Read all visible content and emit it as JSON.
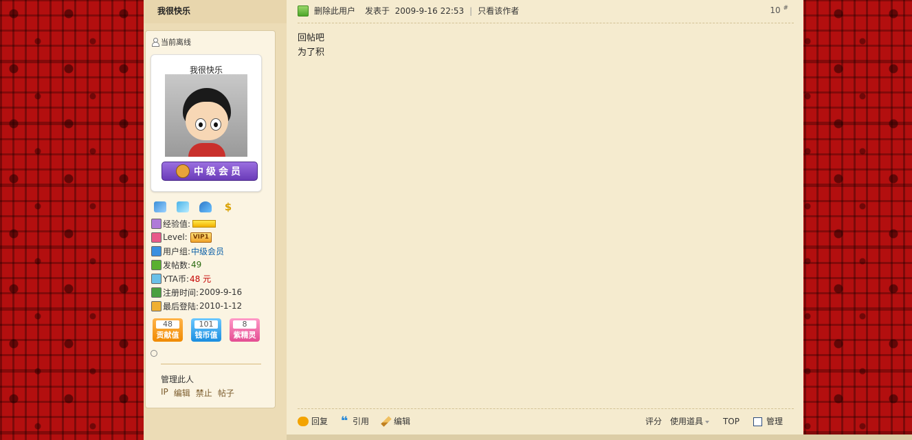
{
  "author": {
    "name": "我很快乐",
    "status": "当前离线",
    "rank_title": "中级会员",
    "stats": {
      "exp_label": "经验值:",
      "level_label": "Level:",
      "level_value": "VIP1",
      "group_label": "用户组:",
      "group_value": "中级会员",
      "posts_label": "发帖数:",
      "posts_value": "49",
      "coins_label": "YTA币:",
      "coins_value": "48 元",
      "reg_label": "注册时间:",
      "reg_value": "2009-9-16",
      "login_label": "最后登陆:",
      "login_value": "2010-1-12"
    },
    "badges": [
      {
        "value": "48",
        "label": "贡献值"
      },
      {
        "value": "101",
        "label": "钱币值"
      },
      {
        "value": "8",
        "label": "紫精灵"
      }
    ],
    "manage_title": "管理此人",
    "manage_links": [
      "IP",
      "编辑",
      "禁止",
      "帖子"
    ]
  },
  "post": {
    "delete_user": "删除此用户",
    "posted_at": "发表于  2009-9-16 22:53",
    "separator": "|",
    "only_author": "只看该作者",
    "floor": "10",
    "floor_mark": "#",
    "lines": [
      "回帖吧",
      "为了积"
    ]
  },
  "footer": {
    "reply": "回复",
    "quote": "引用",
    "edit": "编辑",
    "rate": "评分",
    "use_tool": "使用道具",
    "top": "TOP",
    "manage": "管理"
  },
  "colors": {
    "page_bg": "#b30f0f",
    "post_bg": "#f5ebcf",
    "sidebar_bg": "#ecdcb6",
    "link": "#0a5fa8",
    "coins": "#c40000"
  }
}
